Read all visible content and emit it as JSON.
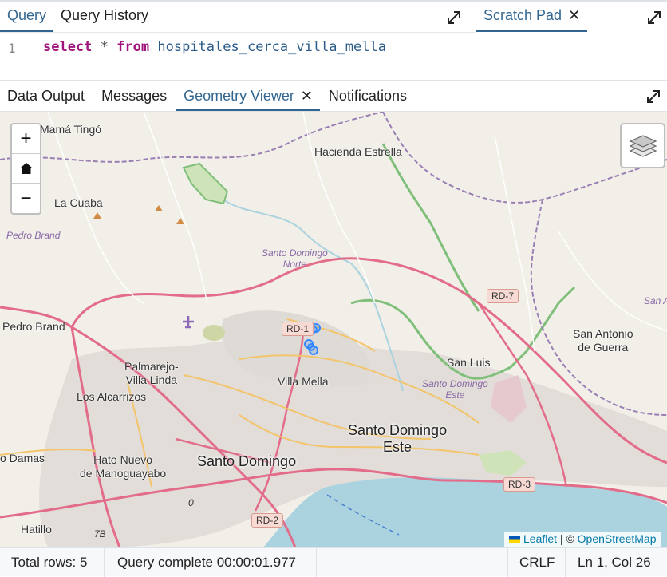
{
  "query_tabs": [
    "Query",
    "Query History"
  ],
  "scratch_tab": "Scratch Pad",
  "editor": {
    "line_number": "1",
    "tokens": {
      "kw1": "select",
      "op": "*",
      "kw2": "from",
      "table": "hospitales_cerca_villa_mella"
    }
  },
  "result_tabs": [
    "Data Output",
    "Messages",
    "Geometry Viewer",
    "Notifications"
  ],
  "map": {
    "labels": {
      "mama_tingo": "Mamá Tingó",
      "hacienda_estrella": "Hacienda Estrella",
      "la_cuaba": "La Cuaba",
      "pedro_brand_area": "Pedro Brand",
      "pedro_brand": "Pedro Brand",
      "sd_norte": "Santo Domingo\nNorte",
      "palmarejo": "Palmarejo-\nVilla Linda",
      "los_alcarrizos": "Los Alcarrizos",
      "villa_mella": "Villa Mella",
      "san_luis": "San Luis",
      "sd_este_area": "Santo Domingo\nEste",
      "sd_este": "Santo Domingo\nEste",
      "san_antonio": "San Antonio\nde Guerra",
      "san_a": "San A",
      "santo_domingo": "Santo Domingo",
      "hato_nuevo": "Hato Nuevo\nde Manoguayabo",
      "damas": "o Damas",
      "hatillo": "Hatillo"
    },
    "shields": {
      "rd7": "RD-7",
      "rd1": "RD-1",
      "rd3": "RD-3",
      "rd2": "RD-2"
    },
    "route_marks": {
      "r7b": "7B",
      "r0": "0"
    },
    "zoom_in": "+",
    "zoom_out": "−",
    "attribution": {
      "leaflet": "Leaflet",
      "sep": " | © ",
      "osm": "OpenStreetMap"
    },
    "colors": {
      "marker": "#3388ff",
      "primary_road": "#e26c89",
      "secondary_road": "#f3c46a",
      "water": "#aad3df",
      "border": "#9a7fb4"
    }
  },
  "status": {
    "total_rows": "Total rows: 5",
    "query_time": "Query complete 00:00:01.977",
    "line_endings": "CRLF",
    "cursor": "Ln 1, Col 26"
  }
}
